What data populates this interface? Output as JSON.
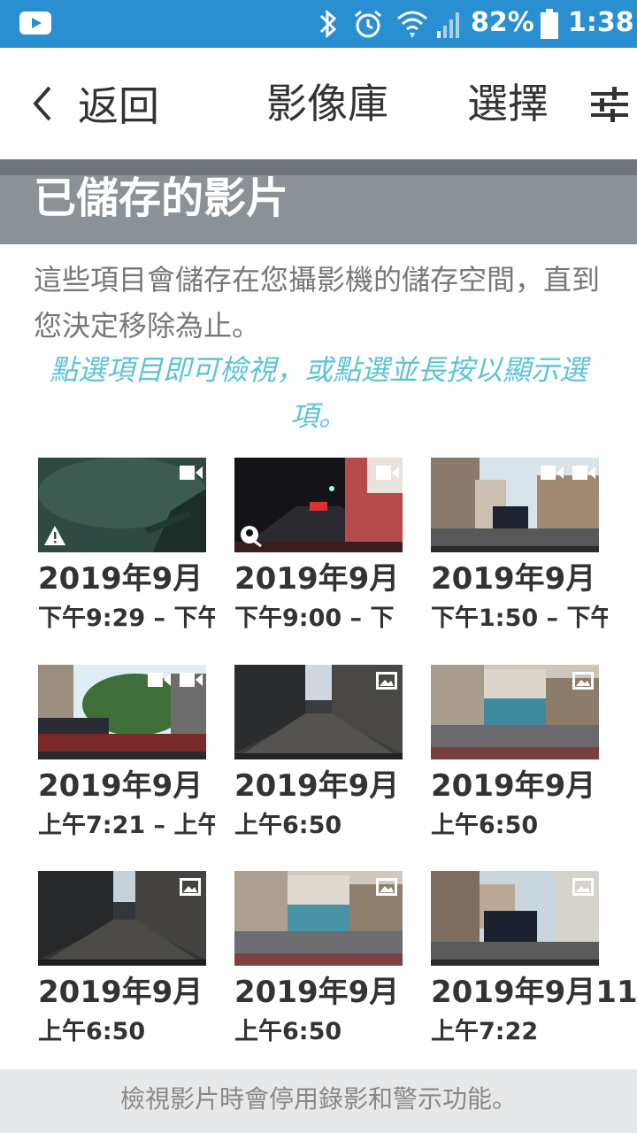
{
  "status_bar": {
    "battery": "82%",
    "time": "1:38",
    "icons": [
      "youtube-icon",
      "bluetooth-icon",
      "alarm-icon",
      "wifi-icon",
      "signal-icon",
      "battery-icon"
    ]
  },
  "nav": {
    "back_label": "返回",
    "title": "影像庫",
    "select_label": "選擇"
  },
  "section": {
    "title": "已儲存的影片",
    "description": "這些項目會儲存在您攝影機的儲存空間，直到您決定移除為止。",
    "hint": "點選項目即可檢視，或點選並長按以顯示選項。"
  },
  "items": [
    {
      "date": "2019年9月",
      "time": "下午9:29 – 下午",
      "type": "video",
      "badge": "warning"
    },
    {
      "date": "2019年9月",
      "time": "下午9:00 – 下",
      "type": "video",
      "badge": "voice"
    },
    {
      "date": "2019年9月",
      "time": "下午1:50 – 下午",
      "type": "video-double"
    },
    {
      "date": "2019年9月",
      "time": "上午7:21 – 上午",
      "type": "video-double"
    },
    {
      "date": "2019年9月",
      "time": "上午6:50",
      "type": "photo"
    },
    {
      "date": "2019年9月",
      "time": "上午6:50",
      "type": "photo"
    },
    {
      "date": "2019年9月",
      "time": "上午6:50",
      "type": "photo"
    },
    {
      "date": "2019年9月",
      "time": "上午6:50",
      "type": "photo"
    },
    {
      "date": "2019年9月11",
      "time": "上午7:22",
      "type": "photo"
    }
  ],
  "footer": "檢視影片時會停用錄影和警示功能。",
  "colors": {
    "status_bar": "#2a8fd0",
    "section_header": "#8b9297",
    "hint_text": "#5cc3d9"
  }
}
